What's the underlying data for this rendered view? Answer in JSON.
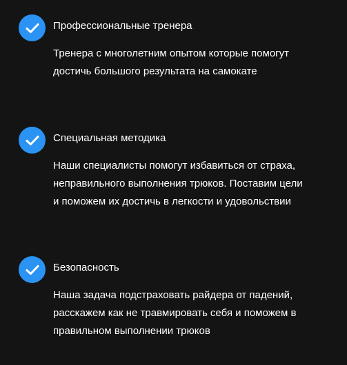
{
  "features": [
    {
      "title": "Профессиональные тренера",
      "lines": [
        "Тренера с многолетним опытом которые помогут",
        "достичь большого результата на самокате"
      ]
    },
    {
      "title": "Специальная методика",
      "lines": [
        "Наши специалисты помогут избавиться от страха,",
        "неправильного выполнения трюков. Поставим цели",
        "и поможем их достичь в легкости и удовольствии"
      ]
    },
    {
      "title": "Безопасность",
      "lines": [
        "Наша задача подстраховать райдера от падений,",
        "расскажем как не травмировать себя и поможем в",
        "правильном выполнении трюков"
      ]
    }
  ],
  "icon": "check-circle-icon",
  "colors": {
    "background": "#141414",
    "accent": "#2b93f3",
    "text": "#ffffff"
  }
}
